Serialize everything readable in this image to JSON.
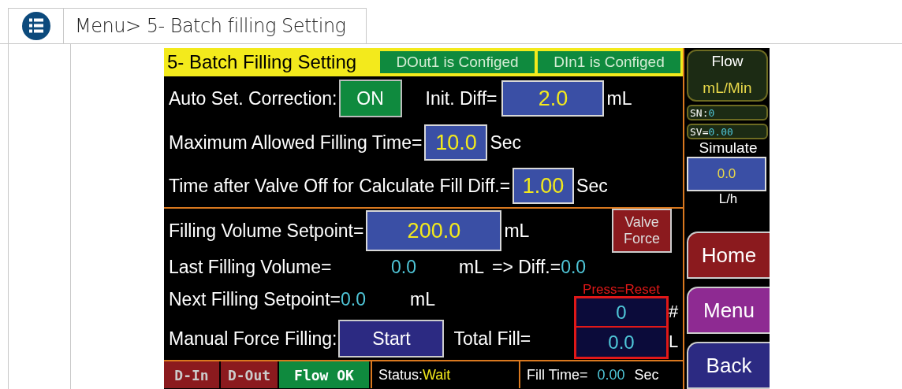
{
  "header": {
    "breadcrumb": "Menu> 5- Batch filling Setting"
  },
  "screen": {
    "title": "5- Batch Filling Setting",
    "badges": [
      "DOut1 is Configed",
      "DIn1 is Configed"
    ],
    "auto_correction": {
      "label": "Auto Set. Correction:",
      "value": "ON",
      "on": true
    },
    "init_diff": {
      "label": "Init. Diff=",
      "value": "2.0",
      "unit": "mL"
    },
    "max_time": {
      "label": "Maximum Allowed Filling Time=",
      "value": "10.0",
      "unit": "Sec"
    },
    "time_after": {
      "label": "Time after Valve Off for Calculate Fill Diff.=",
      "value": "1.00",
      "unit": "Sec"
    },
    "fill_setpoint": {
      "label": "Filling Volume Setpoint=",
      "value": "200.0",
      "unit": "mL"
    },
    "valve_force": "Valve Force",
    "last_volume": {
      "label": "Last Filling Volume=",
      "value": "0.0",
      "unit": "mL",
      "diff_label": "=> Diff.=",
      "diff_value": "0.0"
    },
    "next_setpoint": {
      "label": "Next Filling Setpoint=",
      "value": "0.0",
      "unit": "mL"
    },
    "reset_hint": "Press=Reset",
    "counter": {
      "value": "0",
      "unit": "#"
    },
    "manual": {
      "label": "Manual Force Filling:",
      "button": "Start"
    },
    "total_fill": {
      "label": "Total Fill=",
      "value": "0.0",
      "unit": "L"
    },
    "status_bar": {
      "indicators": [
        {
          "label": "D-In",
          "on": false
        },
        {
          "label": "D-Out",
          "on": false
        },
        {
          "label": "Flow OK",
          "on": true
        }
      ],
      "status_label": "Status:",
      "status_value": "Wait",
      "fill_time_label": "Fill Time=",
      "fill_time_value": "0.00",
      "fill_time_unit": "Sec"
    }
  },
  "side": {
    "flow_title": "Flow",
    "flow_unit": "mL/Min",
    "sn_label": "SN:",
    "sn_value": "0",
    "sv_label": "SV=",
    "sv_value": "0.00",
    "simulate_label": "Simulate",
    "simulate_value": "0.0",
    "simulate_unit": "L/h",
    "nav": [
      {
        "label": "Home",
        "color": "#8b1a1e"
      },
      {
        "label": "Menu",
        "color": "#8e2a92"
      },
      {
        "label": "Back",
        "color": "#2c2a82"
      }
    ]
  }
}
